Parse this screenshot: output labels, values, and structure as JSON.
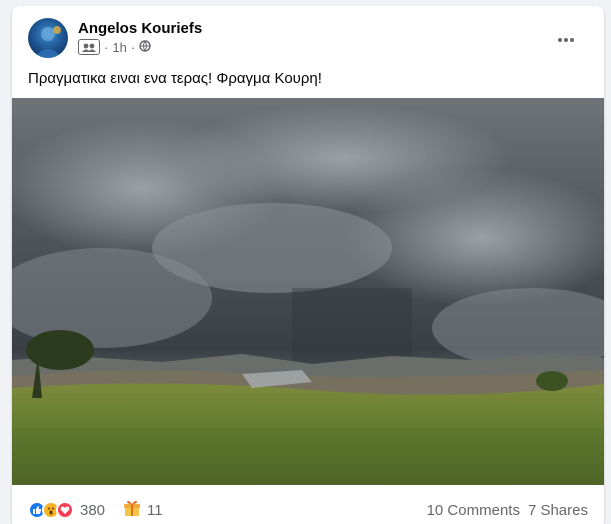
{
  "post": {
    "author": "Angelos Kouriefs",
    "time": "1h",
    "separator": "·",
    "caption": "Πραγματικα ειναι ενα τερας! Φραγμα Κουρη!"
  },
  "icons": {
    "avatar": "avatar",
    "group": "group-icon",
    "privacy": "globe-icon",
    "more": "more-options-icon",
    "reactions": [
      "like-icon",
      "wow-icon",
      "love-icon"
    ],
    "gift": "gift-icon"
  },
  "footer": {
    "reaction_count": "380",
    "gift_count": "11",
    "comments": "10 Comments",
    "shares": "7 Shares"
  },
  "colors": {
    "like": "#1877f2",
    "wow": "#f7b125",
    "love": "#f33e58",
    "secondary_text": "#65676b"
  }
}
